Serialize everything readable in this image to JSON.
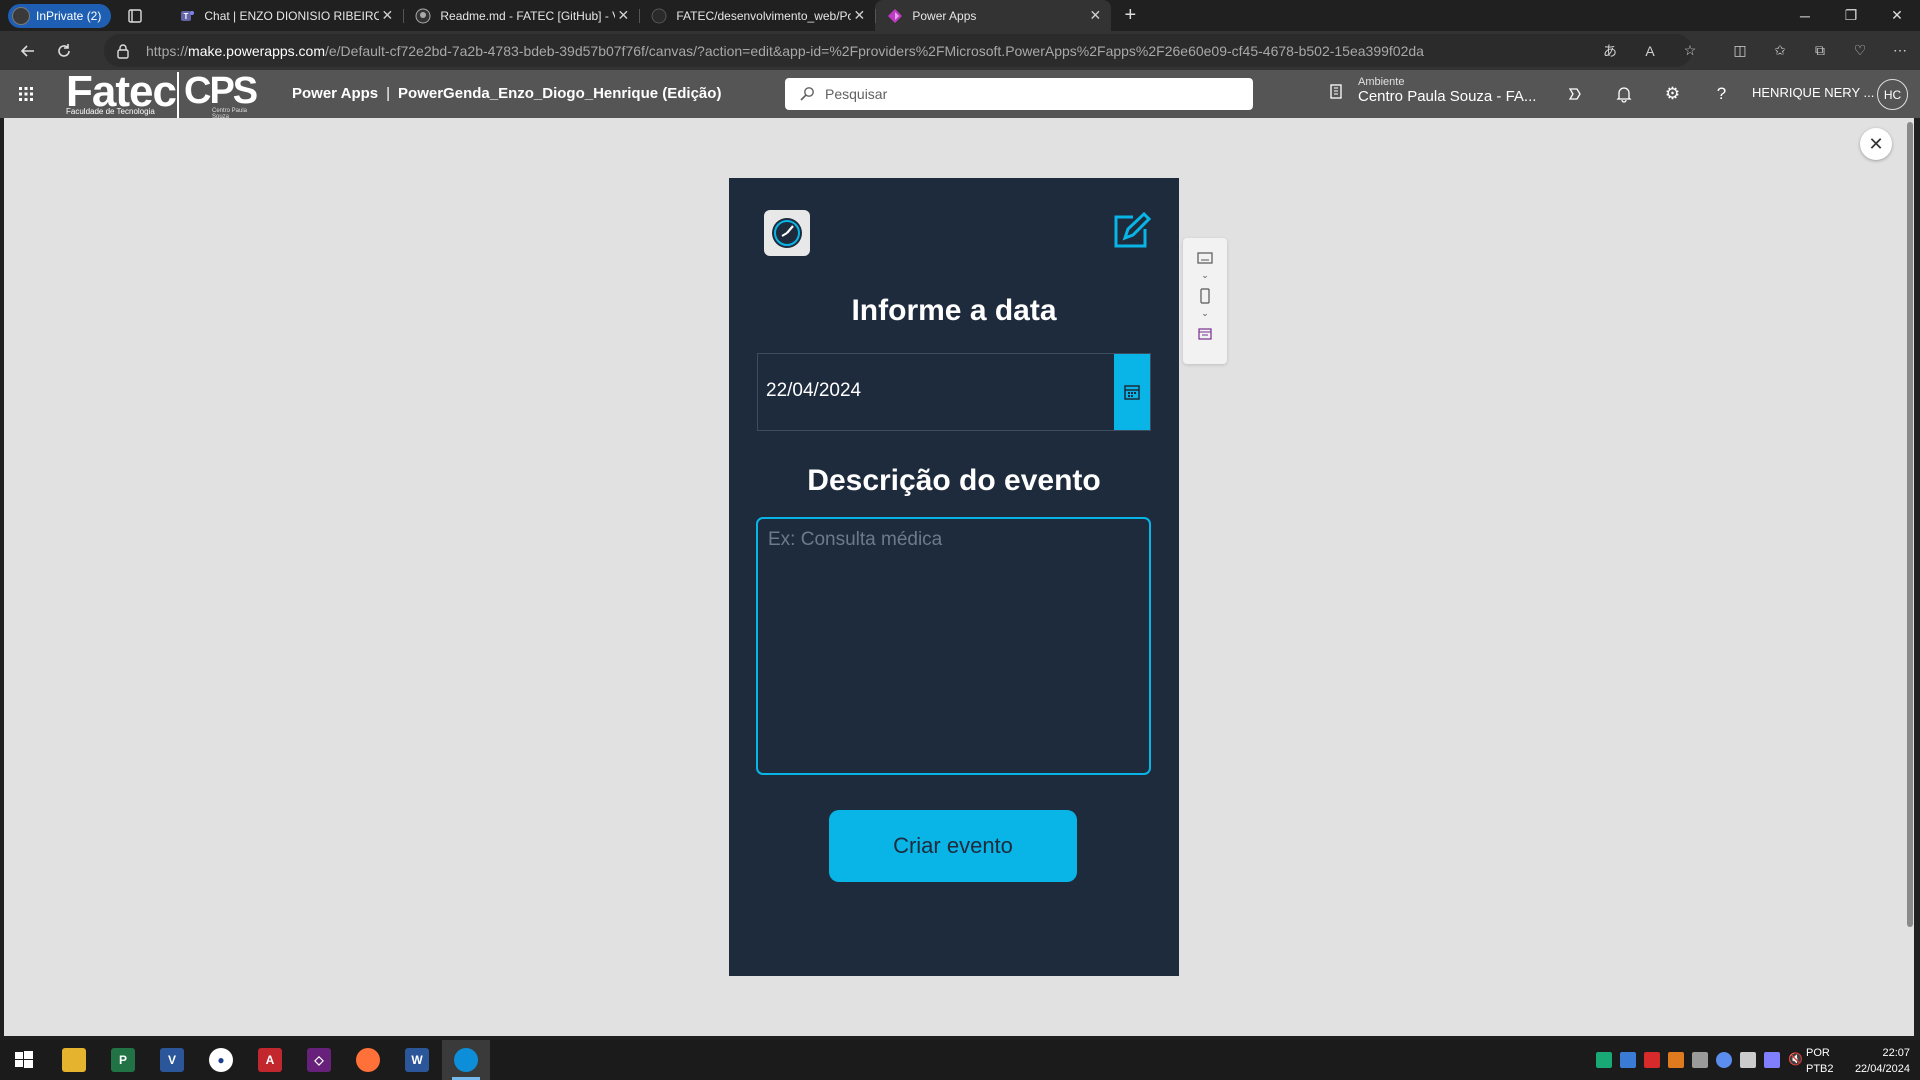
{
  "browser": {
    "profile_label": "InPrivate (2)",
    "tabs": [
      {
        "title": "Chat | ENZO DIONISIO RIBEIRO | V",
        "active": false
      },
      {
        "title": "Readme.md - FATEC [GitHub] - V",
        "active": false
      },
      {
        "title": "FATEC/desenvolvimento_web/Po",
        "active": false
      },
      {
        "title": "Power Apps",
        "active": true
      }
    ],
    "url_prefix": "https://",
    "url_host": "make.powerapps.com",
    "url_path": "/e/Default-cf72e2bd-7a2b-4783-bdeb-39d57b07f76f/canvas/?action=edit&app-id=%2Fproviders%2FMicrosoft.PowerApps%2Fapps%2F26e60e09-cf45-4678-b502-15ea399f02da"
  },
  "header": {
    "logo_text": "Fatec",
    "logo_sub": "Faculdade de Tecnologia",
    "logo_cps": "CPS",
    "logo_cps_sub": "Centro Paula Souza",
    "product": "Power Apps",
    "separator": "|",
    "app_name": "PowerGenda_Enzo_Diogo_Henrique (Edição)",
    "search_placeholder": "Pesquisar",
    "env_label": "Ambiente",
    "env_value": "Centro Paula Souza - FA...",
    "user_name": "HENRIQUE NERY ...",
    "user_initials": "HC"
  },
  "app_screen": {
    "date_title": "Informe a data",
    "date_value": "22/04/2024",
    "desc_title": "Descrição do evento",
    "desc_placeholder": "Ex: Consulta médica",
    "create_button": "Criar evento",
    "colors": {
      "background": "#1e2b3c",
      "accent": "#09b5e6",
      "text": "#ffffff"
    }
  },
  "taskbar": {
    "language": "POR",
    "layout": "PTB2",
    "time": "22:07",
    "date": "22/04/2024"
  }
}
